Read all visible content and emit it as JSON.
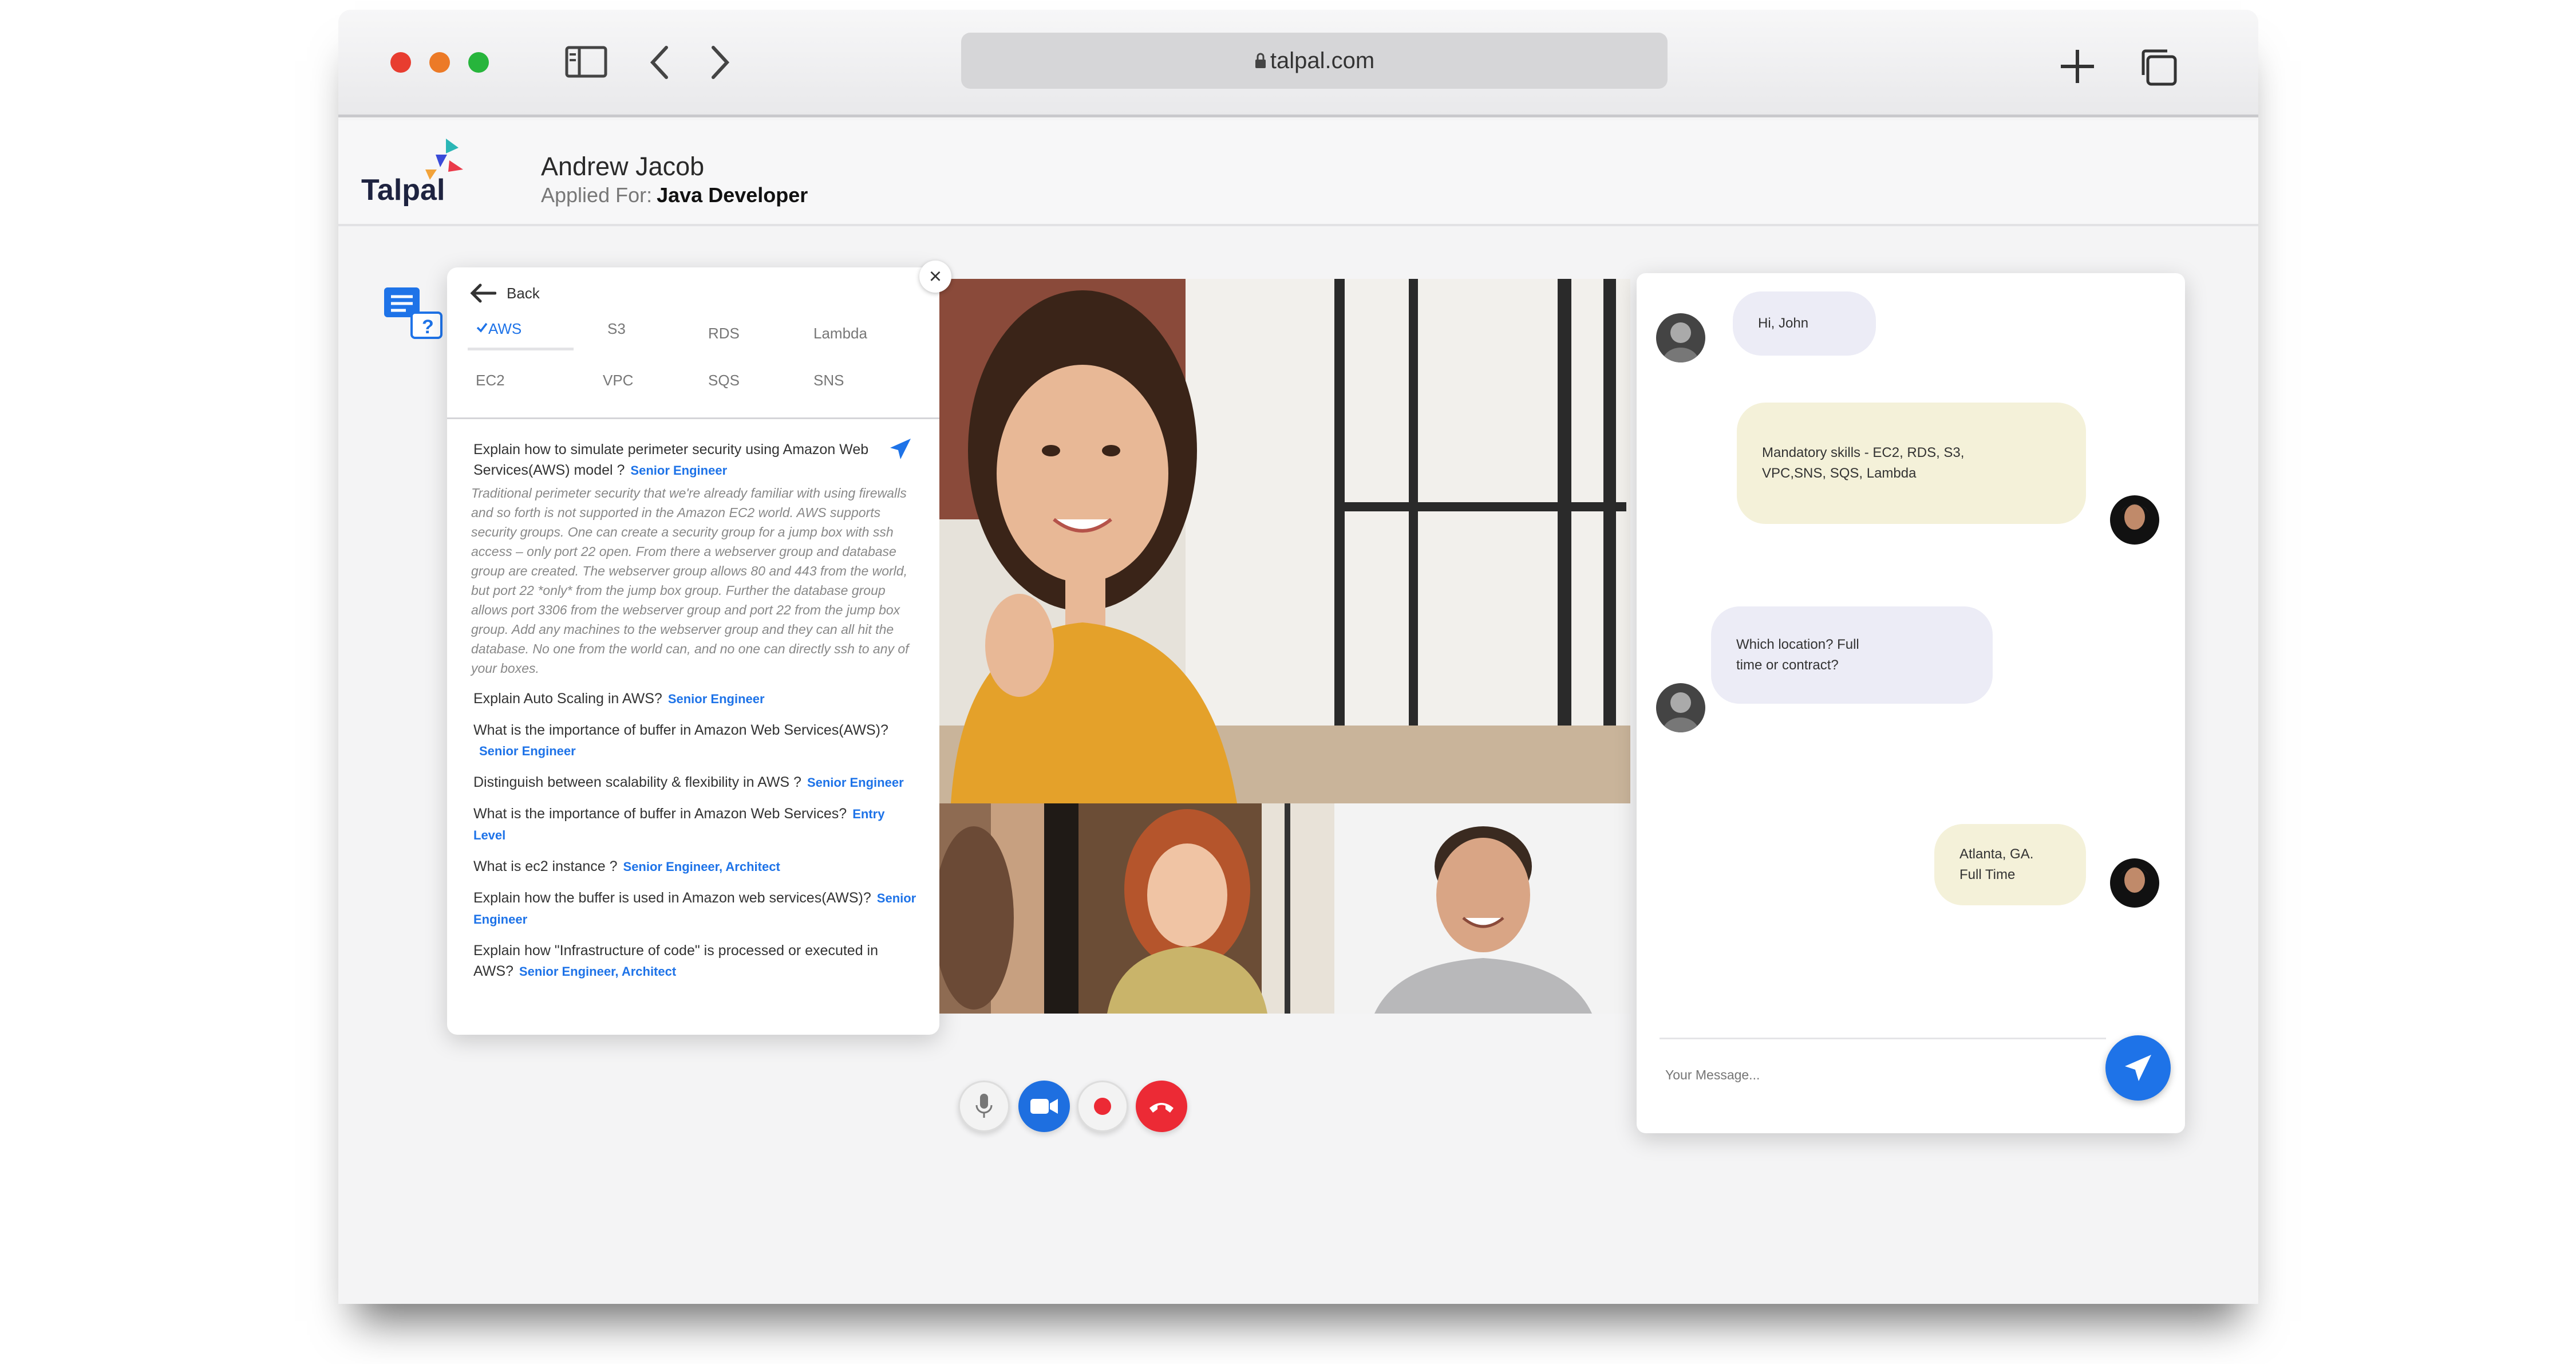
{
  "browser": {
    "url": "talpal.com"
  },
  "app": {
    "logo_text": "Talpal",
    "candidate_name": "Andrew Jacob",
    "applied_for_label": "Applied For:",
    "applied_for_role": "Java Developer"
  },
  "question_panel": {
    "back_label": "Back",
    "tabs": [
      "AWS",
      "S3",
      "RDS",
      "Lambda",
      "EC2",
      "VPC",
      "SQS",
      "SNS"
    ],
    "active_tab": "AWS",
    "questions": [
      {
        "text": "Explain how to simulate perimeter security using Amazon Web Services(AWS) model ?",
        "level": "Senior Engineer",
        "answer": "Traditional perimeter security that we're already familiar with using firewalls and so forth is not supported in the Amazon EC2 world. AWS supports security groups. One can create a security group for a jump box with ssh access – only port 22 open. From there a webserver group and database group are created. The webserver group allows 80 and 443 from the world, but port 22 *only* from the jump box group. Further the database group allows port 3306 from the webserver group and port 22 from the jump box group. Add any machines to the webserver group and they can all hit the database. No one from the world can, and no one can directly ssh to any of your boxes."
      },
      {
        "text": "Explain Auto Scaling in AWS?",
        "level": "Senior Engineer"
      },
      {
        "text": "What is the importance of buffer in Amazon Web Services(AWS)?",
        "level": "Senior Engineer"
      },
      {
        "text": "Distinguish between scalability & flexibility in AWS ?",
        "level": "Senior Engineer"
      },
      {
        "text": "What is the importance of buffer in Amazon Web Services?",
        "level": "Entry Level"
      },
      {
        "text": "What is ec2 instance ?",
        "level": "Senior Engineer, Architect"
      },
      {
        "text": "Explain how the buffer is used in Amazon web services(AWS)?",
        "level": "Senior Engineer"
      },
      {
        "text": "Explain how \"Infrastructure of code\" is processed or executed in AWS?",
        "level": "Senior Engineer, Architect"
      }
    ]
  },
  "chat": {
    "messages": [
      {
        "from": "recruiter",
        "text": "Hi, John"
      },
      {
        "from": "candidate",
        "text": "Mandatory skills - EC2, RDS, S3, VPC,SNS, SQS, Lambda"
      },
      {
        "from": "recruiter",
        "text": "Which location? Full time or contract?"
      },
      {
        "from": "candidate",
        "text": "Atlanta, GA. Full Time"
      }
    ],
    "input_placeholder": "Your Message..."
  },
  "colors": {
    "accent": "#1e73e8",
    "end_call": "#ec2a35",
    "incoming_bubble": "#ececf6",
    "outgoing_bubble": "#f4f1d9"
  }
}
